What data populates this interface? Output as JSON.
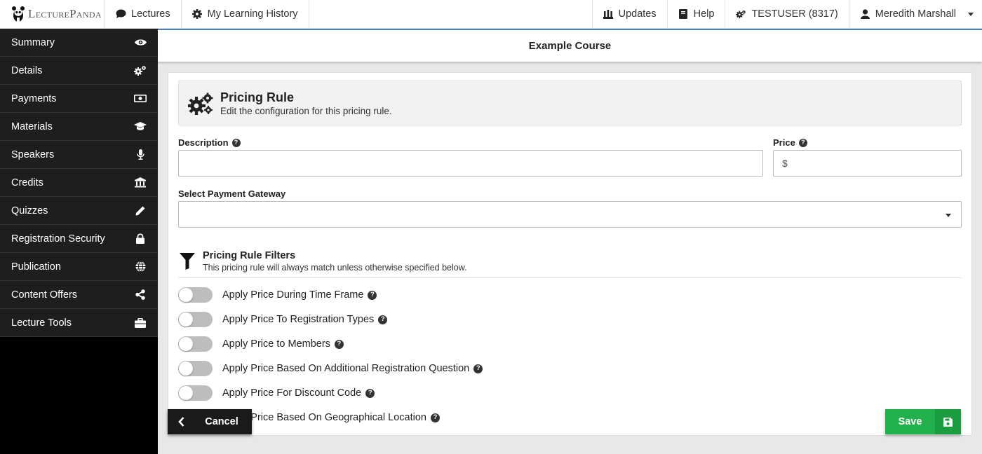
{
  "brand": {
    "logo_text_a": "L",
    "logo_text_b": "ECTURE",
    "logo_text_c": "P",
    "logo_text_d": "ANDA"
  },
  "topnav": {
    "lectures": "Lectures",
    "history": "My Learning History",
    "updates": "Updates",
    "help": "Help",
    "test_user": "TESTUSER (8317)",
    "user_name": "Meredith Marshall"
  },
  "sidebar": {
    "items": [
      {
        "label": "Summary",
        "icon": "eye-icon"
      },
      {
        "label": "Details",
        "icon": "gears-icon"
      },
      {
        "label": "Payments",
        "icon": "money-icon"
      },
      {
        "label": "Materials",
        "icon": "graduation-cap-icon"
      },
      {
        "label": "Speakers",
        "icon": "microphone-icon"
      },
      {
        "label": "Credits",
        "icon": "institution-icon"
      },
      {
        "label": "Quizzes",
        "icon": "pencil-icon"
      },
      {
        "label": "Registration Security",
        "icon": "lock-icon"
      },
      {
        "label": "Publication",
        "icon": "globe-icon"
      },
      {
        "label": "Content Offers",
        "icon": "share-icon"
      },
      {
        "label": "Lecture Tools",
        "icon": "briefcase-icon"
      }
    ]
  },
  "course": {
    "title": "Example Course"
  },
  "rule": {
    "title": "Pricing Rule",
    "subtitle": "Edit the configuration for this pricing rule."
  },
  "form": {
    "description_label": "Description",
    "description_value": "",
    "price_label": "Price",
    "price_prefix": "$",
    "price_value": "",
    "gateway_label": "Select Payment Gateway",
    "gateway_value": ""
  },
  "filters": {
    "title": "Pricing Rule Filters",
    "subtitle": "This pricing rule will always match unless otherwise specified below.",
    "toggles": [
      {
        "label": "Apply Price During Time Frame",
        "on": false
      },
      {
        "label": "Apply Price To Registration Types",
        "on": false
      },
      {
        "label": "Apply Price to Members",
        "on": false
      },
      {
        "label": "Apply Price Based On Additional Registration Question",
        "on": false
      },
      {
        "label": "Apply Price For Discount Code",
        "on": false
      },
      {
        "label": "Apply Price Based On Geographical Location",
        "on": false
      }
    ]
  },
  "actions": {
    "cancel": "Cancel",
    "save": "Save"
  },
  "colors": {
    "save_green": "#21b04b",
    "accent_blue": "#4a7fae",
    "sidebar_bg": "#1e1e1e"
  }
}
